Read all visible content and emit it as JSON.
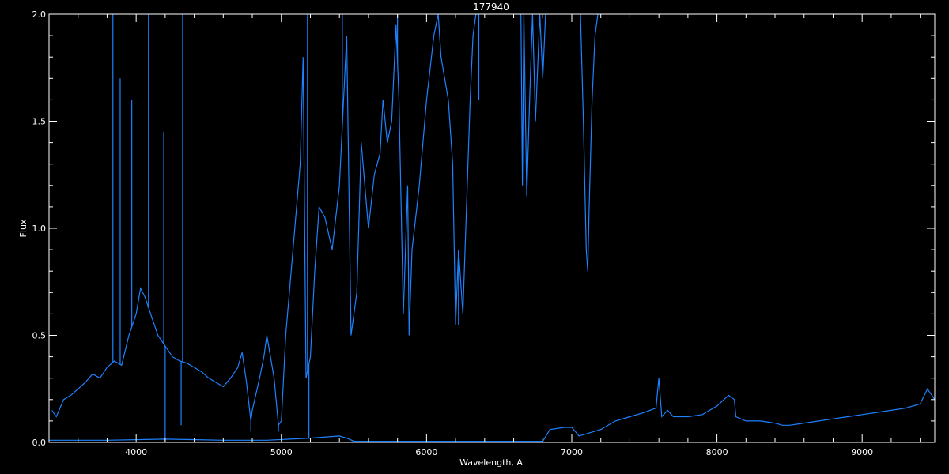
{
  "chart_data": {
    "type": "line",
    "title": "177940",
    "xlabel": "Wavelength, A",
    "ylabel": "Flux",
    "xlim": [
      3400,
      9500
    ],
    "ylim": [
      0.0,
      2.0
    ],
    "x_ticks": [
      4000,
      5000,
      6000,
      7000,
      8000,
      9000
    ],
    "x_tick_labels": [
      "4000",
      "5000",
      "6000",
      "7000",
      "8000",
      "9000"
    ],
    "y_ticks": [
      0.0,
      0.5,
      1.0,
      1.5,
      2.0
    ],
    "y_tick_labels": [
      "0.0",
      "0.5",
      "1.0",
      "1.5",
      "2.0"
    ],
    "x_minor_step": 200,
    "y_minor_step": 0.1,
    "grid": false,
    "background": "#000000",
    "axis_color": "#ffffff",
    "series": [
      {
        "color": "#1e82ff",
        "x": [
          3420,
          3450,
          3500,
          3550,
          3600,
          3650,
          3700,
          3750,
          3800,
          3850,
          3900,
          3950,
          4000,
          4030,
          4060,
          4100,
          4150,
          4200,
          4250,
          4300,
          4350,
          4400,
          4450,
          4500,
          4550,
          4600,
          4650,
          4700,
          4730,
          4760,
          4790,
          4800,
          4850,
          4880,
          4900,
          4950,
          4980,
          5000,
          5030,
          5080,
          5130,
          5150,
          5170,
          5200,
          5230,
          5260,
          5300,
          5350,
          5400,
          5450,
          5480,
          5520,
          5550,
          5600,
          5640,
          5680,
          5700,
          5730,
          5760,
          5790,
          5810,
          5840,
          5870,
          5880,
          5900,
          5950,
          6000,
          6050,
          6080,
          6100,
          6150,
          6180,
          6200,
          6220,
          6250,
          6300,
          6320,
          6340
        ],
        "y": [
          0.15,
          0.12,
          0.2,
          0.22,
          0.25,
          0.28,
          0.32,
          0.3,
          0.35,
          0.38,
          0.36,
          0.5,
          0.6,
          0.72,
          0.68,
          0.6,
          0.5,
          0.45,
          0.4,
          0.38,
          0.37,
          0.35,
          0.33,
          0.3,
          0.28,
          0.26,
          0.3,
          0.35,
          0.42,
          0.28,
          0.1,
          0.15,
          0.3,
          0.4,
          0.5,
          0.3,
          0.08,
          0.1,
          0.5,
          0.9,
          1.3,
          1.8,
          0.3,
          0.4,
          0.8,
          1.1,
          1.05,
          0.9,
          1.2,
          1.9,
          0.5,
          0.7,
          1.4,
          1.0,
          1.25,
          1.35,
          1.6,
          1.4,
          1.5,
          1.95,
          1.6,
          0.6,
          1.2,
          0.5,
          0.9,
          1.2,
          1.6,
          1.9,
          2.0,
          1.8,
          1.6,
          1.3,
          0.55,
          0.9,
          0.6,
          1.6,
          1.9,
          2.0
        ]
      },
      {
        "color": "#1e82ff",
        "x": [
          3400,
          3800,
          4200,
          4600,
          4900,
          5200,
          5400,
          5450,
          5500,
          6000,
          6500,
          6800,
          6850,
          6950,
          7000,
          7050,
          7100,
          7200,
          7300,
          7400,
          7500,
          7580,
          7600,
          7620,
          7660,
          7700,
          7800,
          7900,
          8000,
          8080,
          8120,
          8130,
          8200,
          8300,
          8400,
          8450,
          8500,
          8600,
          8700,
          8800,
          8900,
          9000,
          9100,
          9200,
          9300,
          9400,
          9450,
          9500
        ],
        "y": [
          0.01,
          0.01,
          0.015,
          0.01,
          0.01,
          0.02,
          0.03,
          0.02,
          0.005,
          0.005,
          0.005,
          0.005,
          0.06,
          0.07,
          0.07,
          0.03,
          0.04,
          0.06,
          0.1,
          0.12,
          0.14,
          0.16,
          0.3,
          0.12,
          0.15,
          0.12,
          0.12,
          0.13,
          0.17,
          0.22,
          0.2,
          0.12,
          0.1,
          0.1,
          0.09,
          0.08,
          0.08,
          0.09,
          0.1,
          0.11,
          0.12,
          0.13,
          0.14,
          0.15,
          0.16,
          0.18,
          0.25,
          0.2
        ]
      }
    ],
    "emission_spikes": [
      {
        "x": 3840,
        "y": 2.0
      },
      {
        "x": 3890,
        "y": 1.7
      },
      {
        "x": 3970,
        "y": 1.6
      },
      {
        "x": 4085,
        "y": 2.0
      },
      {
        "x": 4190,
        "y": 1.45
      },
      {
        "x": 4320,
        "y": 2.0
      },
      {
        "x": 5180,
        "y": 2.0
      },
      {
        "x": 5420,
        "y": 2.0
      },
      {
        "x": 5800,
        "y": 2.0
      },
      {
        "x": 6360,
        "y": 1.6
      }
    ],
    "absorption_dips": [
      {
        "x": 4200,
        "y": 0.0
      },
      {
        "x": 4310,
        "y": 0.08
      },
      {
        "x": 4790,
        "y": 0.05
      },
      {
        "x": 4980,
        "y": 0.05
      },
      {
        "x": 5190,
        "y": 0.02
      },
      {
        "x": 5880,
        "y": 0.5
      },
      {
        "x": 6220,
        "y": 0.55
      }
    ],
    "upper_segments": [
      {
        "x": [
          6650,
          6660,
          6670,
          6690,
          6710,
          6730,
          6750,
          6780,
          6800,
          6820
        ],
        "y": [
          2.0,
          1.2,
          2.0,
          1.15,
          1.6,
          2.0,
          1.5,
          2.0,
          1.7,
          2.0
        ]
      },
      {
        "x": [
          7060,
          7080,
          7100,
          7110,
          7120,
          7140,
          7160,
          7180
        ],
        "y": [
          2.0,
          1.5,
          0.9,
          0.8,
          1.1,
          1.6,
          1.9,
          2.0
        ]
      }
    ]
  }
}
